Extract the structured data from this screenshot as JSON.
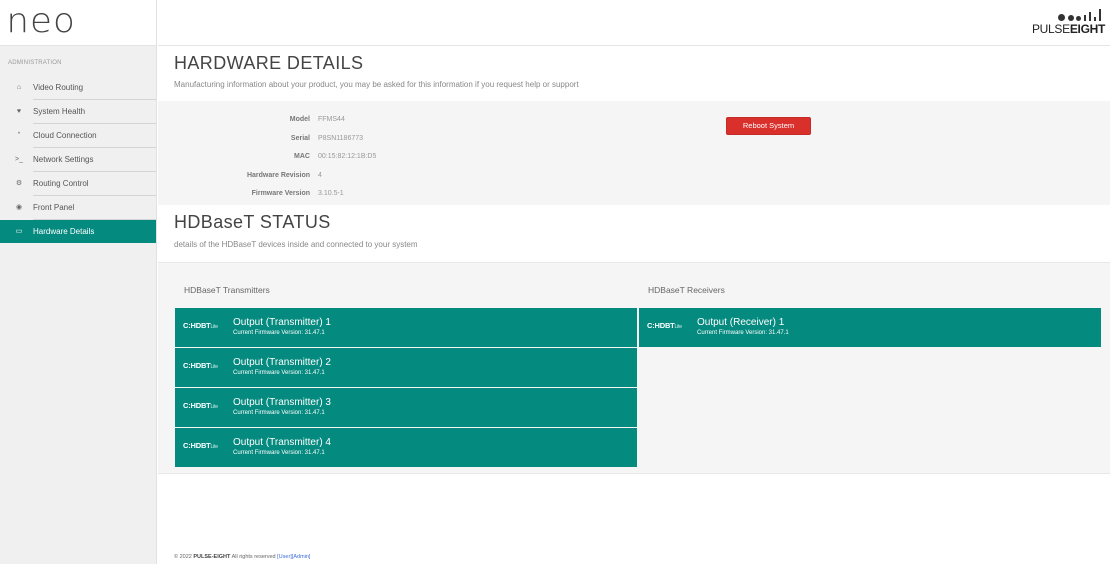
{
  "app": {
    "logo": "neo"
  },
  "brand": {
    "light": "PULSE",
    "bold": "EIGHT"
  },
  "sidebar": {
    "section_label": "ADMINISTRATION",
    "items": [
      {
        "label": "Video Routing",
        "icon": "home-icon",
        "glyph": "⌂",
        "active": false
      },
      {
        "label": "System Health",
        "icon": "heart-icon",
        "glyph": "♥",
        "active": false
      },
      {
        "label": "Cloud Connection",
        "icon": "wifi-icon",
        "glyph": "ʺ",
        "active": false
      },
      {
        "label": "Network Settings",
        "icon": "terminal-icon",
        "glyph": ">_",
        "active": false
      },
      {
        "label": "Routing Control",
        "icon": "gears-icon",
        "glyph": "⚙",
        "active": false
      },
      {
        "label": "Front Panel",
        "icon": "target-icon",
        "glyph": "◉",
        "active": false
      },
      {
        "label": "Hardware Details",
        "icon": "hdd-icon",
        "glyph": "▭",
        "active": true
      }
    ]
  },
  "hardware": {
    "title": "HARDWARE DETAILS",
    "subtitle": "Manufacturing information about your product, you may be asked for this information if you request help or support",
    "rows": [
      {
        "key": "Model",
        "value": "FFMS44"
      },
      {
        "key": "Serial",
        "value": "P8SN1186773"
      },
      {
        "key": "MAC",
        "value": "00:15:82:12:1B:D5"
      },
      {
        "key": "Hardware Revision",
        "value": "4"
      },
      {
        "key": "Firmware Version",
        "value": "3.10.5-1"
      }
    ],
    "reboot_label": "Reboot System"
  },
  "hdbaset": {
    "title": "HDBaseT STATUS",
    "subtitle": "details of the HDBaseT devices inside and connected to your system",
    "transmitters_label": "HDBaseT Transmitters",
    "receivers_label": "HDBaseT Receivers",
    "logo_text": "HDBT",
    "logo_lite": "Lite",
    "transmitters": [
      {
        "name": "Output (Transmitter) 1",
        "firmware": "Current Firmware Version: 31.47.1"
      },
      {
        "name": "Output (Transmitter) 2",
        "firmware": "Current Firmware Version: 31.47.1"
      },
      {
        "name": "Output (Transmitter) 3",
        "firmware": "Current Firmware Version: 31.47.1"
      },
      {
        "name": "Output (Transmitter) 4",
        "firmware": "Current Firmware Version: 31.47.1"
      }
    ],
    "receivers": [
      {
        "name": "Output (Receiver) 1",
        "firmware": "Current Firmware Version: 31.47.1"
      }
    ]
  },
  "footer": {
    "copyright": "© 2022",
    "company": "PULSE-EIGHT",
    "rights": "All rights reserved",
    "user_link": "[User]",
    "admin_link": "[Admin]"
  },
  "colors": {
    "accent": "#048a7f",
    "danger": "#d9302c",
    "sidebar_bg": "#f0f0f0"
  }
}
